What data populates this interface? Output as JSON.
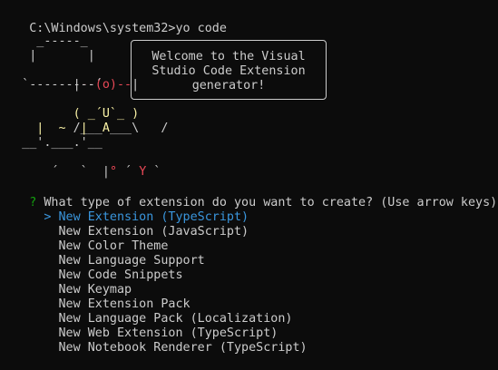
{
  "terminal": {
    "prompt": "C:\\Windows\\system32>",
    "command": "yo code"
  },
  "welcome": {
    "line1": "Welcome to the Visual",
    "line2": "Studio Code Extension",
    "line3": "generator!"
  },
  "art": {
    "row1": "     _-----_",
    "row2": "    |       |",
    "row3_left": "    |",
    "row3_mid": "--(o)--",
    "row3_right": "|",
    "row4": "   `---------´",
    "row5_left": "    ( ",
    "row5_mid": "_´U`_",
    "row5_right": " )",
    "row6_left": "    /___",
    "row6_mid": "A",
    "row6_right": "___\\   /",
    "row7": "     |  ~  |",
    "row8": "   __'.___.'__",
    "row9_left": " ´   `  |",
    "row9_mid": "°",
    "row9_right": " ´ ",
    "row9_y": "Y",
    "row9_end": " `"
  },
  "question": {
    "marker": "?",
    "text": " What type of extension do you want to create?",
    "hint": " (Use arrow keys)"
  },
  "menu": {
    "pointer": ">",
    "items": [
      "New Extension (TypeScript)",
      "New Extension (JavaScript)",
      "New Color Theme",
      "New Language Support",
      "New Code Snippets",
      "New Keymap",
      "New Extension Pack",
      "New Language Pack (Localization)",
      "New Web Extension (TypeScript)",
      "New Notebook Renderer (TypeScript)"
    ],
    "selected_index": 0
  },
  "colors": {
    "background": "#0c0c0c",
    "foreground": "#cccccc",
    "accent_red": "#e74856",
    "accent_yellow": "#f9f1a5",
    "question_green": "#13a10e",
    "selected_cyan": "#3a96dd"
  }
}
